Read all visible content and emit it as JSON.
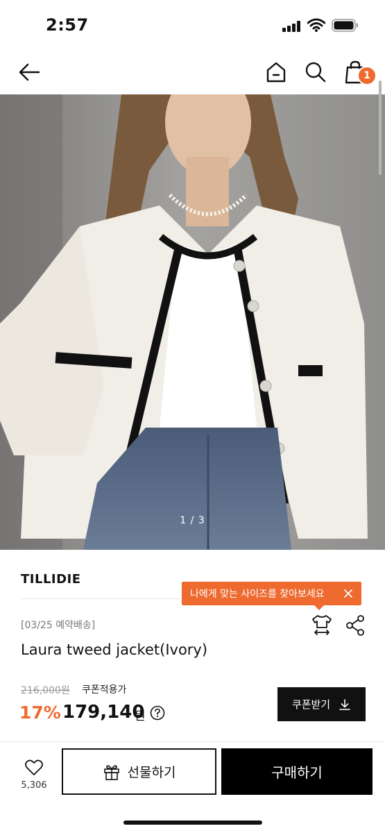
{
  "status_bar": {
    "time": "2:57",
    "icons": [
      "signal-icon",
      "wifi-icon",
      "battery-icon"
    ]
  },
  "nav": {
    "icons": [
      "back-arrow-icon",
      "home-icon",
      "search-icon",
      "shopping-bag-icon"
    ],
    "cart_count": "1"
  },
  "gallery": {
    "indicator": "1 / 3"
  },
  "product": {
    "brand": "TILLIDIE",
    "size_tooltip": "나에게 맞는 사이즈를 찾아보세요",
    "ship_note": "[03/25 예약배송]",
    "name": "Laura tweed jacket(Ivory)",
    "original_price": "216,000원",
    "coupon_note": "쿠폰적용가",
    "discount": "17%",
    "sale_price": "179,140",
    "currency": "원",
    "coupon_button": "쿠폰받기"
  },
  "bottom_bar": {
    "like_count": "5,306",
    "gift_label": "선물하기",
    "buy_label": "구매하기"
  },
  "colors": {
    "accent": "#ee6a2f",
    "dark": "#111111"
  }
}
